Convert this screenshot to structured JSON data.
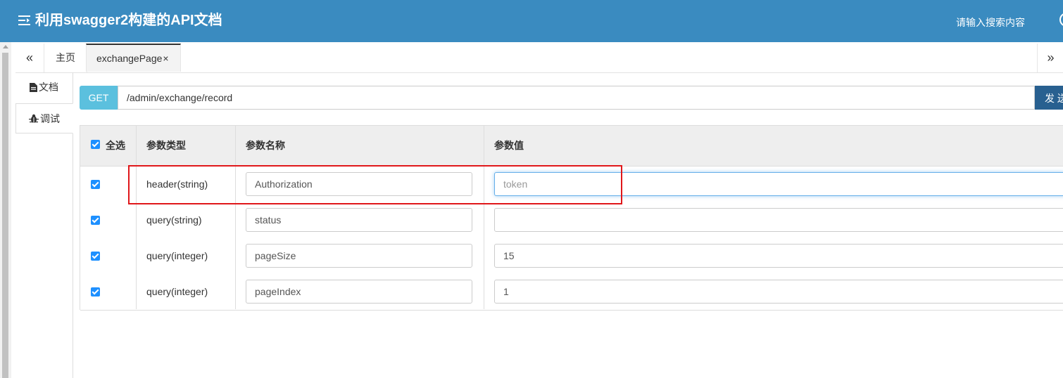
{
  "header": {
    "title": "利用swagger2构建的API文档",
    "search_text": "请输入搜索内容"
  },
  "tabs": {
    "nav_left": "«",
    "home_label": "主页",
    "active_label": "exchangePage",
    "close_glyph": "×",
    "nav_right": "»"
  },
  "side_tabs": {
    "doc_label": "文档",
    "debug_label": "调试"
  },
  "request": {
    "method": "GET",
    "url": "/admin/exchange/record",
    "send_label": "发 送"
  },
  "params_table": {
    "headers": {
      "select_all": "全选",
      "type": "参数类型",
      "name": "参数名称",
      "value": "参数值"
    },
    "rows": [
      {
        "checked": true,
        "type": "header(string)",
        "name": "Authorization",
        "value": "",
        "placeholder": "token"
      },
      {
        "checked": true,
        "type": "query(string)",
        "name": "status",
        "value": "",
        "placeholder": ""
      },
      {
        "checked": true,
        "type": "query(integer)",
        "name": "pageSize",
        "value": "15",
        "placeholder": ""
      },
      {
        "checked": true,
        "type": "query(integer)",
        "name": "pageIndex",
        "value": "1",
        "placeholder": ""
      }
    ]
  },
  "colors": {
    "topbar": "#3a8bc0",
    "method_badge": "#5bc0de",
    "send_button": "#286090",
    "checkbox": "#1e90ff",
    "highlight": "#e0171a"
  },
  "icons": {
    "menu": "menu-indent-icon",
    "user": "user-circle-icon",
    "doc": "file-text-icon",
    "debug": "bug-icon"
  }
}
